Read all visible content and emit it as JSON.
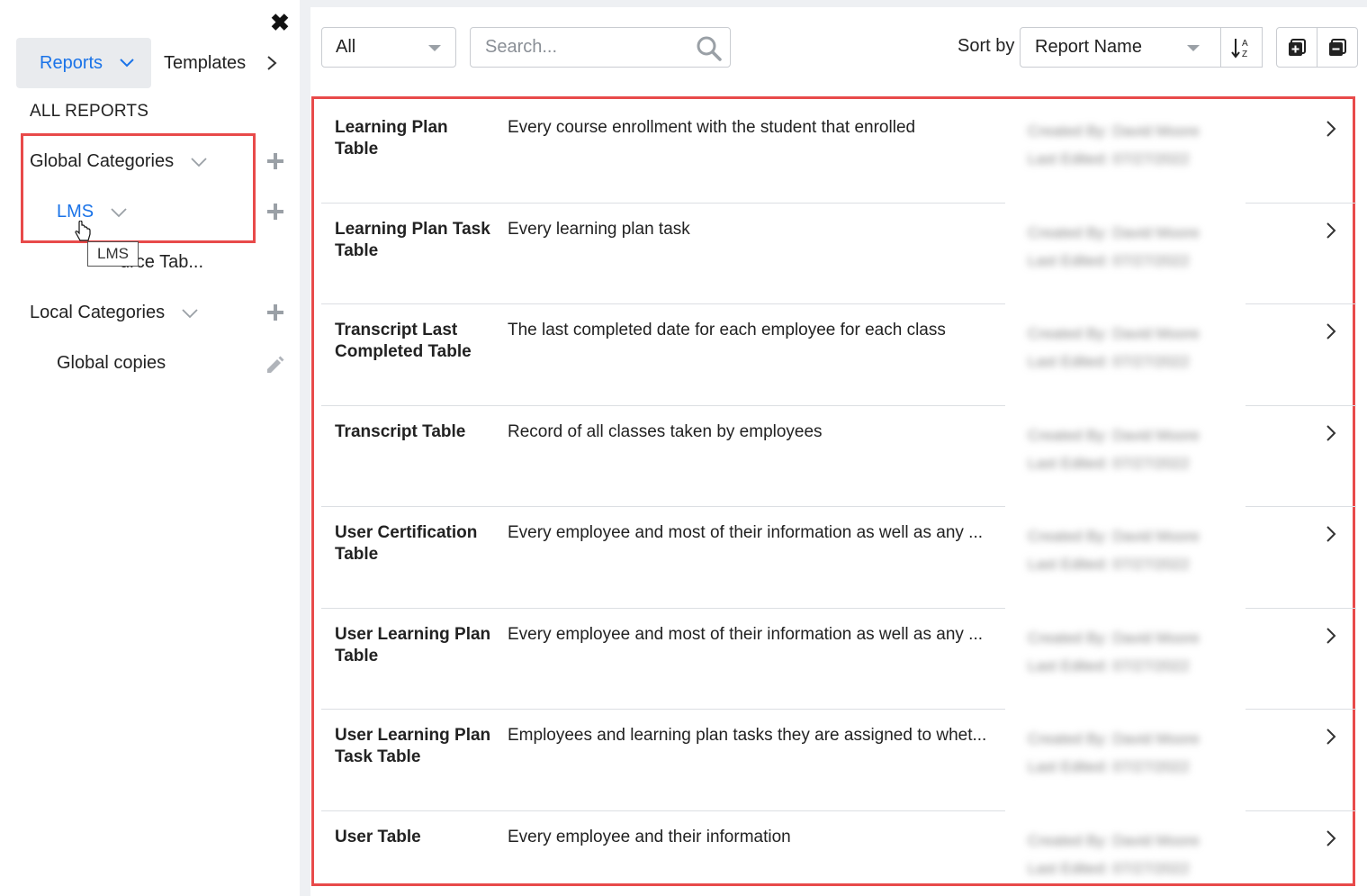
{
  "sidebar": {
    "close_icon": "close-icon",
    "tabs": {
      "reports_label": "Reports",
      "templates_label": "Templates"
    },
    "all_reports_label": "ALL REPORTS",
    "global_categories_label": "Global Categories",
    "lms_label": "LMS",
    "lms_tooltip": "LMS",
    "lms_child_label": "urce Tab...",
    "local_categories_label": "Local Categories",
    "global_copies_label": "Global copies"
  },
  "toolbar": {
    "filter_value": "All",
    "search_placeholder": "Search...",
    "sort_label": "Sort by",
    "sort_value": "Report Name",
    "sort_direction_icon": "sort-alpha-down-icon",
    "expand_all_icon": "expand-all-icon",
    "collapse_all_icon": "collapse-all-icon"
  },
  "colors": {
    "accent": "#1a73e8",
    "highlight_border": "#e84a4a",
    "tab_background": "#e9ebee",
    "panel_divider": "#eef0f3"
  },
  "reports": [
    {
      "name": "Learning Plan Table",
      "description": "Every course enrollment with the student that enrolled",
      "created_by": "Created By: David Moore",
      "last_edited": "Last Edited: 07/27/2022"
    },
    {
      "name": "Learning Plan Task Table",
      "description": "Every learning plan task",
      "created_by": "Created By: David Moore",
      "last_edited": "Last Edited: 07/27/2022"
    },
    {
      "name": "Transcript Last Completed Table",
      "description": "The last completed date for each employee for each class",
      "created_by": "Created By: David Moore",
      "last_edited": "Last Edited: 07/27/2022"
    },
    {
      "name": "Transcript Table",
      "description": "Record of all classes taken by employees",
      "created_by": "Created By: David Moore",
      "last_edited": "Last Edited: 07/27/2022"
    },
    {
      "name": "User Certification Table",
      "description": "Every employee and most of their information as well as any ...",
      "created_by": "Created By: David Moore",
      "last_edited": "Last Edited: 07/27/2022"
    },
    {
      "name": "User Learning Plan Table",
      "description": "Every employee and most of their information as well as any ...",
      "created_by": "Created By: David Moore",
      "last_edited": "Last Edited: 07/27/2022"
    },
    {
      "name": "User Learning Plan Task Table",
      "description": "Employees and learning plan tasks they are assigned to whet...",
      "created_by": "Created By: David Moore",
      "last_edited": "Last Edited: 07/27/2022"
    },
    {
      "name": "User Table",
      "description": "Every employee and their information",
      "created_by": "Created By: David Moore",
      "last_edited": "Last Edited: 07/27/2022"
    }
  ]
}
